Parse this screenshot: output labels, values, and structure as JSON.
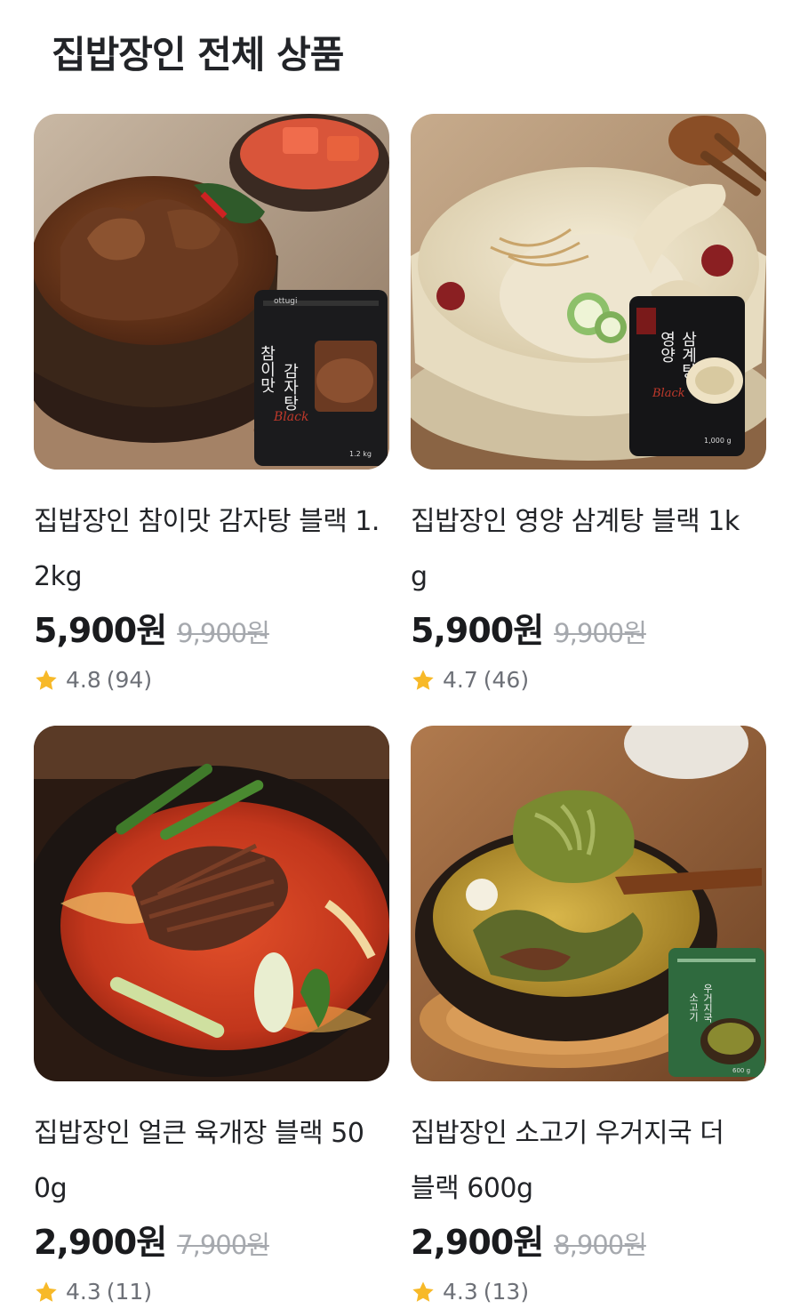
{
  "page": {
    "title": "집밥장인 전체 상품"
  },
  "products": [
    {
      "name": "집밥장인 참이맛 감자탕 블랙 1.2kg",
      "name_line1": "집밥장인 참이맛 감자탕 블랙 1.",
      "name_line2": "2kg",
      "price": "5,900원",
      "original_price": "9,900원",
      "rating": "4.8",
      "review_count": "(94)",
      "image": "gamjatang-photo",
      "pack_brand": "ottugi",
      "pack_label_1": "참이맛",
      "pack_label_2": "감자탕",
      "pack_script": "Black",
      "pack_weight": "1.2 kg"
    },
    {
      "name": "집밥장인 영양 삼계탕 블랙 1kg",
      "name_line1": "집밥장인 영양 삼계탕 블랙 1k",
      "name_line2": "g",
      "price": "5,900원",
      "original_price": "9,900원",
      "rating": "4.7",
      "review_count": "(46)",
      "image": "samgyetang-photo",
      "pack_label_1": "영양",
      "pack_label_2": "삼계탕",
      "pack_script": "Black",
      "pack_weight": "1,000 g"
    },
    {
      "name": "집밥장인 얼큰 육개장 블랙 500g",
      "name_line1": "집밥장인 얼큰 육개장 블랙 50",
      "name_line2": "0g",
      "price": "2,900원",
      "original_price": "7,900원",
      "rating": "4.3",
      "review_count": "(11)",
      "image": "yukgaejang-photo"
    },
    {
      "name": "집밥장인 소고기 우거지국 더 블랙 600g",
      "name_line1": "집밥장인 소고기 우거지국 더",
      "name_line2": "블랙 600g",
      "price": "2,900원",
      "original_price": "8,900원",
      "rating": "4.3",
      "review_count": "(13)",
      "image": "ugeojiguk-photo",
      "pack_label_1": "소고기",
      "pack_label_2": "우거지국",
      "pack_weight": "600 g"
    }
  ],
  "colors": {
    "star": "#f7b928",
    "price": "#1a1b1e",
    "strike": "#a6a9ae",
    "rating_text": "#6d7077"
  }
}
